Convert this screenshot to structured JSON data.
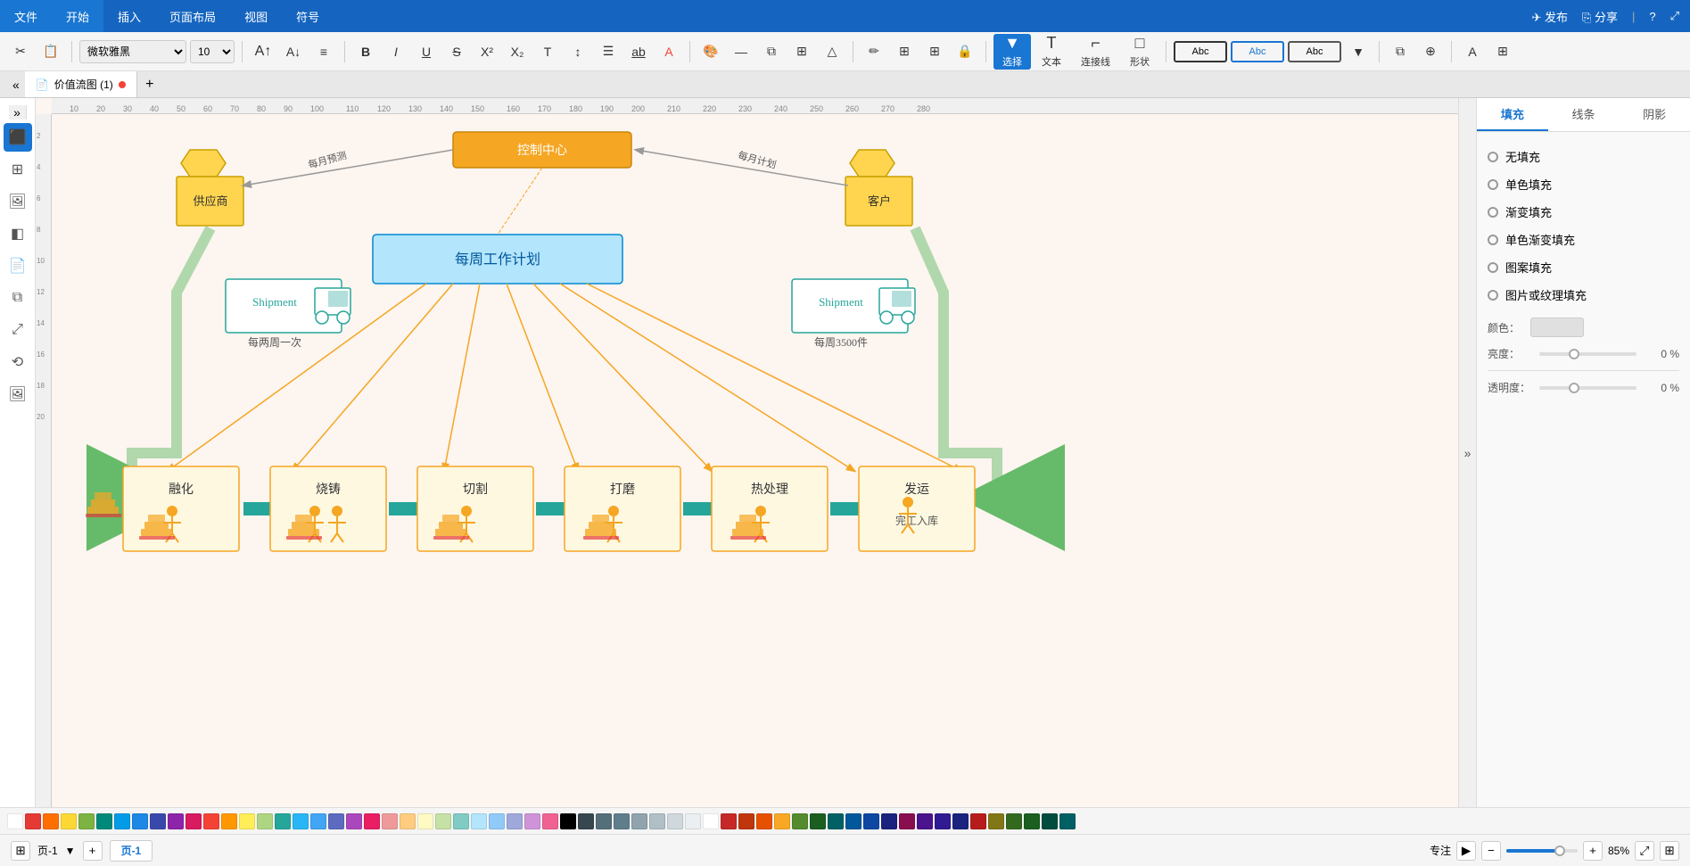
{
  "menu": {
    "items": [
      "文件",
      "开始",
      "插入",
      "页面布局",
      "视图",
      "符号"
    ],
    "active": "开始",
    "right": [
      "发布",
      "分享",
      "?"
    ]
  },
  "toolbar": {
    "font": "微软雅黑",
    "font_size": "10",
    "tools": [
      {
        "id": "select",
        "label": "选择",
        "icon": "▼"
      },
      {
        "id": "text",
        "label": "文本",
        "icon": "T"
      },
      {
        "id": "connect",
        "label": "连接线",
        "icon": "⌐"
      },
      {
        "id": "shape",
        "label": "形状",
        "icon": "□"
      }
    ]
  },
  "tabs": {
    "items": [
      {
        "label": "价值流图 (1)",
        "active": true
      }
    ]
  },
  "diagram": {
    "title": "每周工作计划",
    "supplier": "供应商",
    "customer": "客户",
    "shipment1_label": "Shipment",
    "shipment2_label": "Shipment",
    "freq1": "每两周一次",
    "freq2": "每周3500件",
    "forecast1": "每月预测",
    "forecast2": "每月计划",
    "processes": [
      "融化",
      "烧铸",
      "切割",
      "打磨",
      "热处理",
      "发运"
    ],
    "sub_label": "完工入库"
  },
  "right_panel": {
    "tabs": [
      "填充",
      "线条",
      "阴影"
    ],
    "active_tab": "填充",
    "fill_options": [
      "无填充",
      "单色填充",
      "渐变填充",
      "单色渐变填充",
      "图案填充",
      "图片或纹理填充"
    ],
    "color_label": "颜色：",
    "brightness_label": "亮度：",
    "transparency_label": "透明度：",
    "slider1_val": "0 %",
    "slider2_val": "0 %"
  },
  "palette": {
    "colors": [
      "#ffffff",
      "#e53935",
      "#ff6f00",
      "#fdd835",
      "#7cb342",
      "#00897b",
      "#039be5",
      "#1e88e5",
      "#3949ab",
      "#8e24aa",
      "#d81b60",
      "#f44336",
      "#ff9800",
      "#ffee58",
      "#aed581",
      "#26a69a",
      "#29b6f6",
      "#42a5f5",
      "#5c6bc0",
      "#ab47bc",
      "#e91e63",
      "#ef9a9a",
      "#ffcc80",
      "#fff9c4",
      "#c5e1a5",
      "#80cbc4",
      "#b3e5fc",
      "#90caf9",
      "#9fa8da",
      "#ce93d8",
      "#f06292",
      "#000000",
      "#37474f",
      "#546e7a",
      "#607d8b",
      "#90a4ae",
      "#b0bec5",
      "#cfd8dc",
      "#eceff1",
      "#ffffff",
      "#c62828",
      "#bf360c",
      "#e65100",
      "#f9a825",
      "#558b2f",
      "#1b5e20",
      "#006064",
      "#01579b",
      "#0d47a1",
      "#1a237e",
      "#880e4f",
      "#4a148c",
      "#311b92",
      "#1b237e",
      "#b71c1c",
      "#827717",
      "#33691e",
      "#1b5e20",
      "#004d40",
      "#006064"
    ]
  },
  "bottom": {
    "page_label": "页-1",
    "focus": "专注",
    "zoom": "85%"
  }
}
